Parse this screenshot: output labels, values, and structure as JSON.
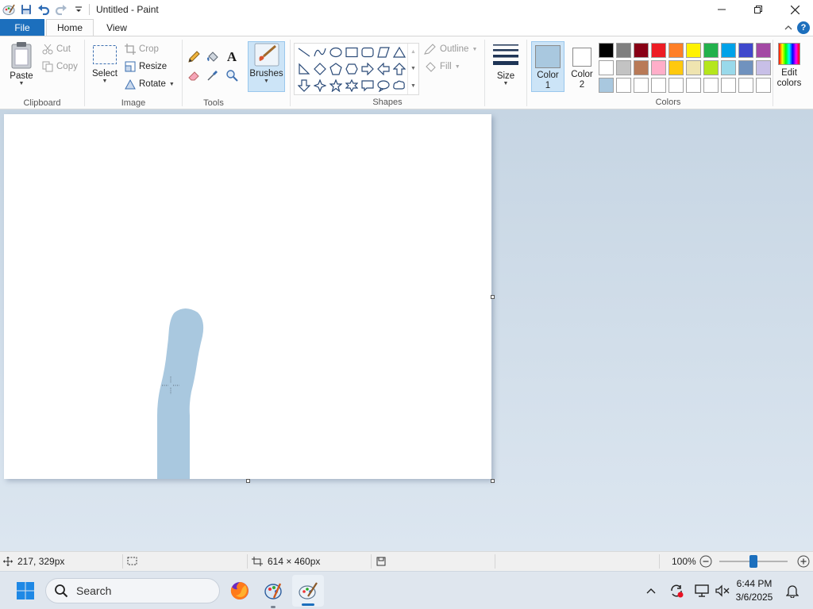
{
  "window": {
    "title": "Untitled - Paint"
  },
  "tabs": [
    {
      "label": "File"
    },
    {
      "label": "Home"
    },
    {
      "label": "View"
    }
  ],
  "clipboard": {
    "paste": "Paste",
    "cut": "Cut",
    "copy": "Copy",
    "label": "Clipboard"
  },
  "image": {
    "select": "Select",
    "crop": "Crop",
    "resize": "Resize",
    "rotate": "Rotate",
    "label": "Image"
  },
  "tools": {
    "label": "Tools",
    "text_tool_glyph": "A"
  },
  "brushes": {
    "label": "Brushes"
  },
  "shapes": {
    "outline": "Outline",
    "fill": "Fill",
    "label": "Shapes"
  },
  "size": {
    "label": "Size"
  },
  "colors": {
    "color1_label": "Color",
    "color1_num": "1",
    "color2_label": "Color",
    "color2_num": "2",
    "edit_label": "Edit",
    "edit_label2": "colors",
    "label": "Colors",
    "color1_value": "#a9c8df",
    "color2_value": "#ffffff",
    "palette_row1": [
      "#000000",
      "#7f7f7f",
      "#880015",
      "#ed1c24",
      "#ff7f27",
      "#fff200",
      "#22b14c",
      "#00a2e8",
      "#3f48cc",
      "#a349a4"
    ],
    "palette_row2": [
      "#ffffff",
      "#c3c3c3",
      "#b97a57",
      "#ffaec9",
      "#ffc90e",
      "#efe4b0",
      "#b5e61d",
      "#99d9ea",
      "#7092be",
      "#c8bfe7"
    ],
    "palette_row3": [
      "#a9c8df",
      "#ffffff",
      "#ffffff",
      "#ffffff",
      "#ffffff",
      "#ffffff",
      "#ffffff",
      "#ffffff",
      "#ffffff",
      "#ffffff"
    ]
  },
  "status": {
    "cursor_position": "217, 329px",
    "canvas_size": "614 × 460px",
    "zoom": "100%",
    "zoom_fraction": 0.5
  },
  "taskbar": {
    "search_label": "Search",
    "time": "6:44 PM",
    "date": "3/6/2025"
  }
}
